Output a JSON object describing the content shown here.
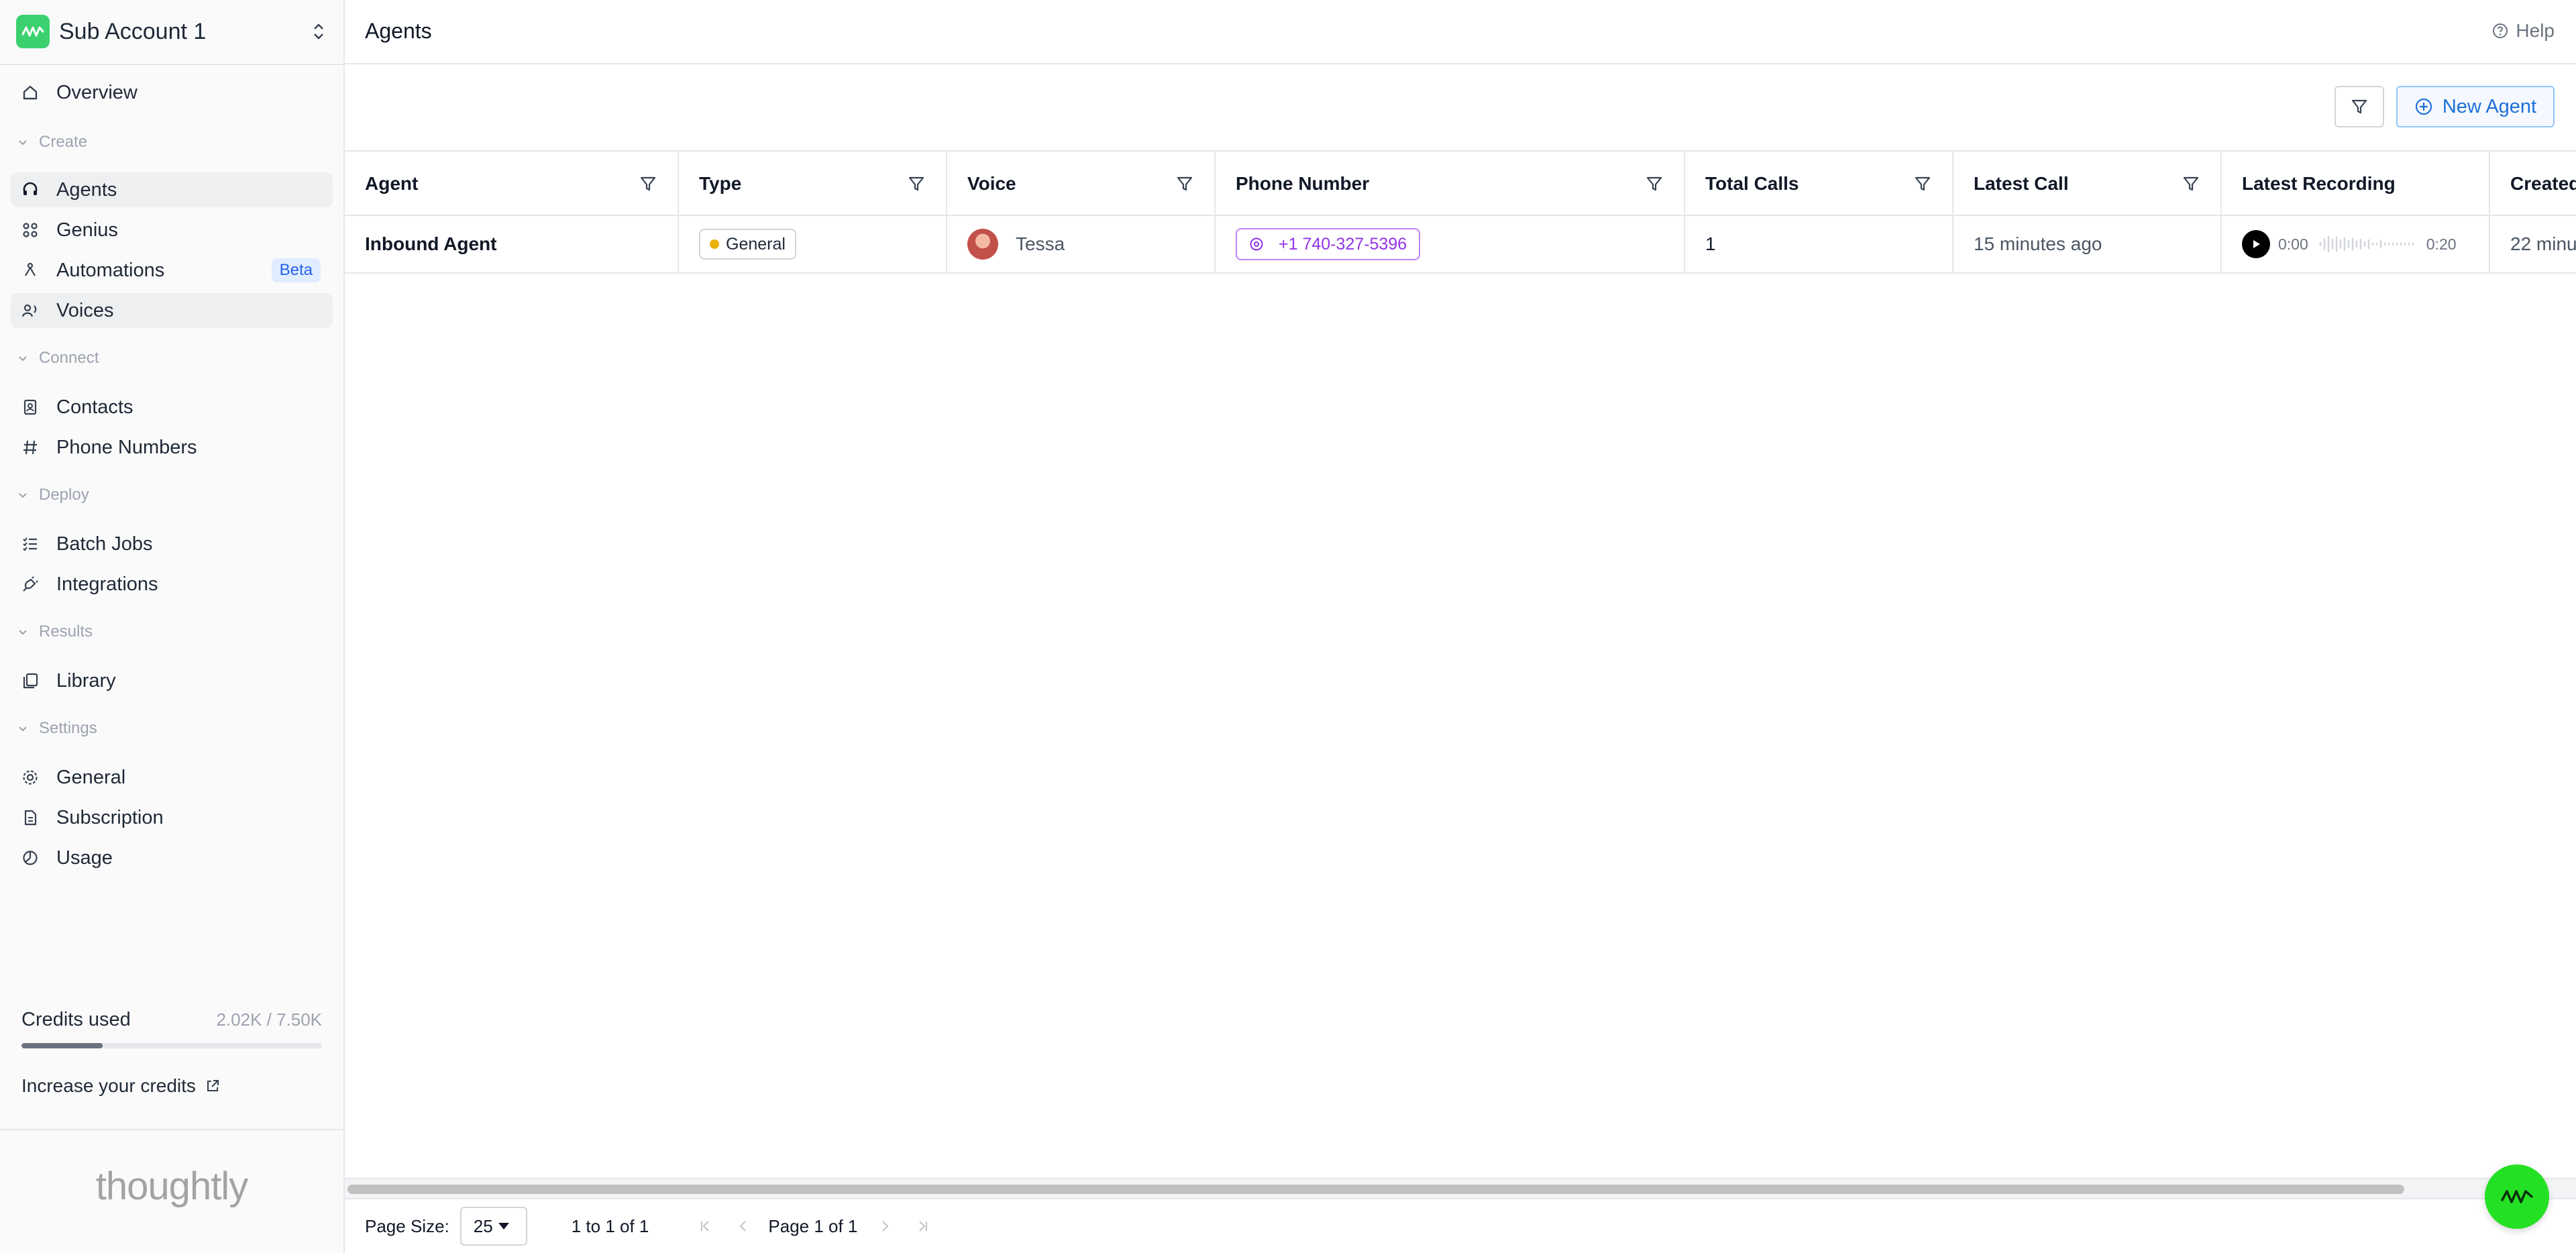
{
  "account": {
    "name": "Sub Account 1"
  },
  "colors": {
    "brand": "#3bd16f",
    "accent": "#1d6fd8",
    "phone_pill": "#9333ea",
    "type_dot": "#eab308",
    "fab": "#24e024"
  },
  "sidebar": {
    "overview": {
      "label": "Overview",
      "icon": "home-icon"
    },
    "sections": {
      "create": "Create",
      "connect": "Connect",
      "deploy": "Deploy",
      "results": "Results",
      "settings": "Settings"
    },
    "items": [
      {
        "label": "Agents",
        "icon": "headset-icon"
      },
      {
        "label": "Genius",
        "icon": "grid-icon"
      },
      {
        "label": "Automations",
        "icon": "automation-icon",
        "badge": "Beta"
      },
      {
        "label": "Voices",
        "icon": "voices-icon"
      },
      {
        "label": "Contacts",
        "icon": "contacts-icon"
      },
      {
        "label": "Phone Numbers",
        "icon": "hash-icon"
      },
      {
        "label": "Batch Jobs",
        "icon": "list-icon"
      },
      {
        "label": "Integrations",
        "icon": "plug-icon"
      },
      {
        "label": "Library",
        "icon": "library-icon"
      },
      {
        "label": "General",
        "icon": "gear-icon"
      },
      {
        "label": "Subscription",
        "icon": "document-icon"
      },
      {
        "label": "Usage",
        "icon": "pie-icon"
      }
    ],
    "credits": {
      "label": "Credits used",
      "value": "2.02K / 7.50K",
      "used_fraction": 0.27
    },
    "increase_label": "Increase your credits",
    "brand": "thoughtly"
  },
  "header": {
    "title": "Agents",
    "help": "Help"
  },
  "toolbar": {
    "new_agent": "New Agent"
  },
  "grid": {
    "columns": [
      "Agent",
      "Type",
      "Voice",
      "Phone Number",
      "Total Calls",
      "Latest Call",
      "Latest Recording",
      "Created"
    ],
    "rows": [
      {
        "agent": "Inbound Agent",
        "type": "General",
        "voice": "Tessa",
        "phone": "+1 740-327-5396",
        "total_calls": "1",
        "latest_call": "15 minutes ago",
        "recording_start": "0:00",
        "recording_end": "0:20",
        "created": "22 minu"
      }
    ]
  },
  "pager": {
    "page_size_label": "Page Size:",
    "page_size": "25",
    "range": "1 to 1 of 1",
    "page": "Page 1 of 1"
  }
}
